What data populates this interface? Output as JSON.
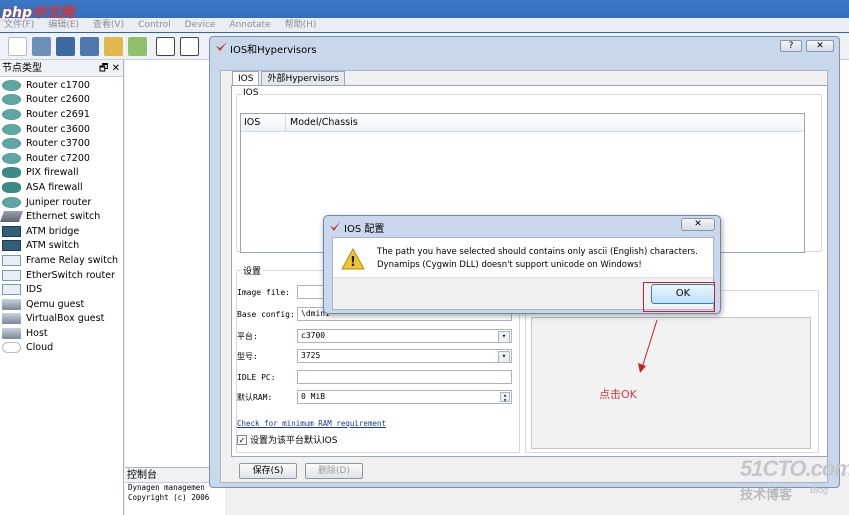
{
  "watermark_logo": "php中文网",
  "menu": [
    "文件(F)",
    "编辑(E)",
    "查看(V)",
    "Control",
    "Device",
    "Annotate",
    "帮助(H)"
  ],
  "left_panel": {
    "title": "节点类型",
    "float_glyph": "🗗",
    "close_glyph": "✕",
    "nodes": [
      {
        "label": "Router c1700",
        "icon": "router"
      },
      {
        "label": "Router c2600",
        "icon": "router"
      },
      {
        "label": "Router c2691",
        "icon": "router"
      },
      {
        "label": "Router c3600",
        "icon": "router"
      },
      {
        "label": "Router c3700",
        "icon": "router"
      },
      {
        "label": "Router c7200",
        "icon": "router"
      },
      {
        "label": "PIX firewall",
        "icon": "firewall"
      },
      {
        "label": "ASA firewall",
        "icon": "firewall"
      },
      {
        "label": "Juniper router",
        "icon": "router"
      },
      {
        "label": "Ethernet switch",
        "icon": "switch"
      },
      {
        "label": "ATM bridge",
        "icon": "atm"
      },
      {
        "label": "ATM switch",
        "icon": "atm"
      },
      {
        "label": "Frame Relay switch",
        "icon": "box"
      },
      {
        "label": "EtherSwitch router",
        "icon": "box"
      },
      {
        "label": "IDS",
        "icon": "box"
      },
      {
        "label": "Qemu guest",
        "icon": "pc"
      },
      {
        "label": "VirtualBox guest",
        "icon": "pc"
      },
      {
        "label": "Host",
        "icon": "pc"
      },
      {
        "label": "Cloud",
        "icon": "cloud"
      }
    ]
  },
  "console": {
    "title": "控制台",
    "lines": [
      "Dynagen managemen",
      "Copyright (c) 2006"
    ]
  },
  "dialog": {
    "title": "IOS和Hypervisors",
    "help_glyph": "?",
    "close_glyph": "✕",
    "tabs": [
      "IOS",
      "外部Hypervisors"
    ],
    "ios_group_label": "IOS",
    "table_headers": [
      "IOS",
      "Model/Chassis"
    ],
    "settings_label": "设置",
    "image_file_label": "Image file:",
    "image_file_value": "",
    "base_config_label": "Base config:",
    "base_config_value": "\\dmini",
    "platform_label": "平台:",
    "platform_value": "c3700",
    "model_label": "型号:",
    "model_value": "3725",
    "idle_pc_label": "IDLE PC:",
    "idle_pc_value": "",
    "ram_label": "默认RAM:",
    "ram_value": "0 MiB",
    "ram_link": "Check for minimum RAM requirement",
    "default_checkbox": "设置为该平台默认IOS",
    "check_glyph": "✓",
    "save_button": "保存(S)",
    "delete_button": "删除(D)"
  },
  "popup": {
    "title": "IOS 配置",
    "close_glyph": "✕",
    "warning_glyph": "!",
    "message": "The path you have selected should contains only ascii (English) characters. Dynamips (Cygwin DLL) doesn't support unicode on Windows!",
    "ok_button": "OK"
  },
  "annotation": "点击OK",
  "watermark": {
    "main": "51CTO.com",
    "sub": "技术博客",
    "tag": "Blog"
  },
  "colors": {
    "highlight_red": "#c8202a",
    "annotation_red": "#d6383f"
  }
}
